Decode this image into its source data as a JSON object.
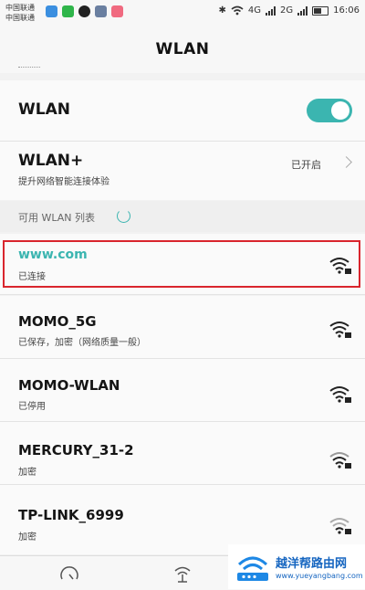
{
  "status_bar": {
    "carrier_1": "中国联通",
    "carrier_2": "中国联通",
    "net_1": "4G",
    "net_2": "2G",
    "time": "16:06"
  },
  "header": {
    "title": "WLAN"
  },
  "wlan_toggle": {
    "label": "WLAN",
    "state": "on"
  },
  "wlan_plus": {
    "label": "WLAN+",
    "subtitle": "提升网络智能连接体验",
    "status": "已开启"
  },
  "section": {
    "available_title": "可用 WLAN 列表"
  },
  "networks": [
    {
      "ssid": "www.com",
      "status": "已连接",
      "ssid_color": "#3bb5b0"
    },
    {
      "ssid": "MOMO_5G",
      "status": "已保存，加密（网络质量一般）"
    },
    {
      "ssid": "MOMO-WLAN",
      "status": "已停用"
    },
    {
      "ssid": "MERCURY_31-2",
      "status": "加密"
    },
    {
      "ssid": "TP-LINK_6999",
      "status": "加密"
    }
  ],
  "watermark": {
    "title": "越洋帮路由网",
    "url": "www.yueyangbang.com"
  },
  "icons": {
    "bottom_left": "speed-test-icon",
    "bottom_center": "wifi-scan-icon",
    "network_signal": "wifi-lock-icon"
  }
}
